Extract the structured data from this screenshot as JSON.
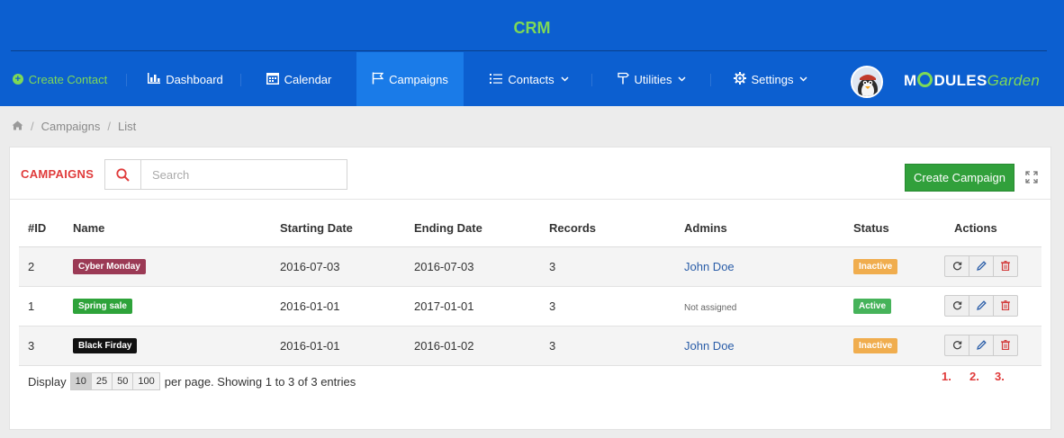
{
  "header": {
    "title": "CRM",
    "logo_text_a": "M",
    "logo_text_b": "DULES",
    "logo_text_c": "Garden"
  },
  "nav": {
    "create_contact": "Create Contact",
    "dashboard": "Dashboard",
    "calendar": "Calendar",
    "campaigns": "Campaigns",
    "contacts": "Contacts",
    "utilities": "Utilities",
    "settings": "Settings"
  },
  "breadcrumb": {
    "campaigns": "Campaigns",
    "list": "List"
  },
  "panel": {
    "title": "CAMPAIGNS",
    "search_placeholder": "Search",
    "create_label": "Create Campaign"
  },
  "table": {
    "headers": {
      "id": "#ID",
      "name": "Name",
      "start": "Starting Date",
      "end": "Ending Date",
      "records": "Records",
      "admins": "Admins",
      "status": "Status",
      "actions": "Actions"
    },
    "rows": [
      {
        "id": "2",
        "name": "Cyber Monday",
        "name_color": "#9b3a55",
        "start": "2016-07-03",
        "end": "2016-07-03",
        "records": "3",
        "admin": "John Doe",
        "status": "Inactive",
        "status_color": "#f0ad4e"
      },
      {
        "id": "1",
        "name": "Spring sale",
        "name_color": "#2ea33a",
        "start": "2016-01-01",
        "end": "2017-01-01",
        "records": "3",
        "admin": "Not assigned",
        "status": "Active",
        "status_color": "#46b35a"
      },
      {
        "id": "3",
        "name": "Black Firday",
        "name_color": "#111111",
        "start": "2016-01-01",
        "end": "2016-01-02",
        "records": "3",
        "admin": "John Doe",
        "status": "Inactive",
        "status_color": "#f0ad4e"
      }
    ]
  },
  "footer": {
    "display": "Display",
    "page_sizes": [
      "10",
      "25",
      "50",
      "100"
    ],
    "selected_page_size": "10",
    "summary": "per page. Showing 1 to 3 of 3 entries"
  },
  "annotations": [
    "1.",
    "2.",
    "3."
  ],
  "icons": {
    "home": "home-icon",
    "search": "search-icon",
    "refresh": "refresh-icon",
    "edit": "pencil-icon",
    "delete": "trash-icon"
  },
  "colors": {
    "header_bg": "#0c5fd0",
    "active_nav": "#1a7be8",
    "accent_green": "#7ed957",
    "title_red": "#e03b3b",
    "create_button": "#31a03b"
  }
}
